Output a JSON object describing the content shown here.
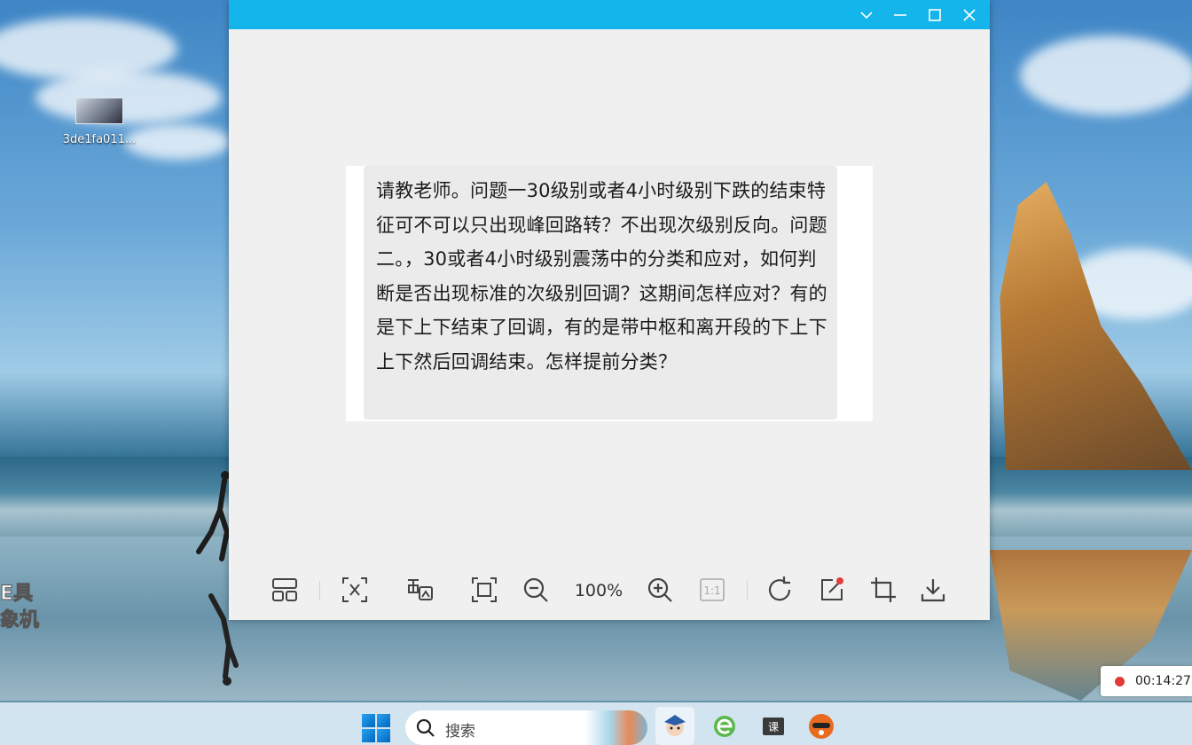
{
  "desktop": {
    "icons": [
      {
        "label": "3de1fa011..."
      }
    ],
    "overlay_text": [
      "E具",
      "象机"
    ]
  },
  "viewer": {
    "titlebar": {
      "buttons": [
        "chevron-down-icon",
        "minimize-icon",
        "maximize-icon",
        "close-icon"
      ]
    },
    "image_text": "请教老师。问题一30级别或者4小时级别下跌的结束特征可不可以只出现峰回路转？不出现次级别反向。问题二。，30或者4小时级别震荡中的分类和应对，如何判断是否出现标准的次级别回调？这期间怎样应对？有的是下上下结束了回调，有的是带中枢和离开段的下上下上下然后回调结束。怎样提前分类？",
    "toolbar": {
      "zoom_level": "100%",
      "actual_size_label": "1:1",
      "tools": [
        "thumbnail-icon",
        "translate-icon",
        "ocr-icon",
        "fit-screen-icon",
        "zoom-out-icon",
        "zoom-in-icon",
        "actual-size-icon",
        "rotate-icon",
        "edit-icon",
        "crop-icon",
        "download-icon"
      ]
    }
  },
  "recorder": {
    "time": "00:14:27"
  },
  "taskbar": {
    "search_placeholder": "搜索",
    "apps": [
      "start-icon",
      "search-icon",
      "avatar-app-icon",
      "browser-app-icon",
      "class-app-icon",
      "mascot-app-icon"
    ],
    "class_app_glyph": "课"
  },
  "colors": {
    "titlebar": "#13b5ea",
    "window_bg": "#f0f0f0",
    "record_dot": "#e03a3a"
  }
}
